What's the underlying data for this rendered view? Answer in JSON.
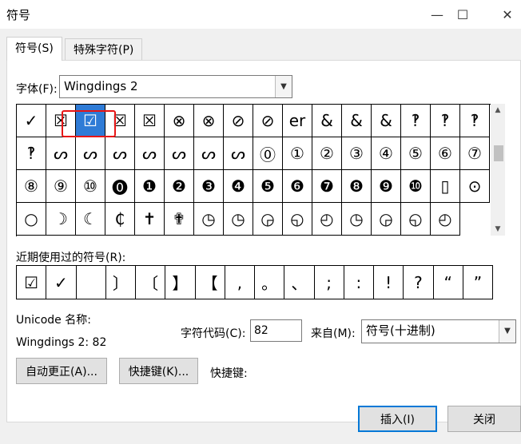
{
  "window": {
    "title": "符号",
    "minimize": "—",
    "maximize": "☐",
    "close": "✕"
  },
  "tabs": [
    {
      "label": "符号(S)"
    },
    {
      "label": "特殊字符(P)"
    }
  ],
  "font": {
    "label": "字体(F):",
    "value": "Wingdings 2"
  },
  "symbol_rows": [
    [
      "✓",
      "☒",
      "☑",
      "☒",
      "☒",
      "⊗",
      "⊗",
      "⊘",
      "⊘",
      "er",
      "&",
      "&",
      "&",
      "‽",
      "‽",
      "‽"
    ],
    [
      "‽",
      "ᔕ",
      "ᔕ",
      "ᔕ",
      "ᔕ",
      "ᔕ",
      "ᔕ",
      "ᔕ",
      "⓪",
      "①",
      "②",
      "③",
      "④",
      "⑤",
      "⑥"
    ],
    [
      "⑦",
      "⑧",
      "⑨",
      "⑩",
      "⓿",
      "❶",
      "❷",
      "❸",
      "❹",
      "❺",
      "❻",
      "❼",
      "❽",
      "❾",
      "❿",
      "▯"
    ],
    [
      "⊙",
      "○",
      "☽",
      "☾",
      "₵",
      "✝",
      "✟",
      "◷",
      "◷",
      "◶",
      "◵",
      "◴",
      "◷",
      "◶",
      "◵",
      "◴"
    ]
  ],
  "selected_index": 2,
  "recent": {
    "label": "近期使用过的符号(R):",
    "items": [
      "☑",
      "✓",
      "",
      "〕",
      "〔",
      "】",
      "【",
      ",",
      "。",
      "、",
      ";",
      ":",
      "!",
      "?",
      "“",
      "”"
    ]
  },
  "unicode": {
    "label": "Unicode 名称:",
    "name": "Wingdings 2: 82"
  },
  "char_code": {
    "label": "字符代码(C):",
    "value": "82"
  },
  "from": {
    "label": "来自(M):",
    "value": "符号(十进制)"
  },
  "buttons": {
    "autocorrect": "自动更正(A)...",
    "shortcut_key": "快捷键(K)...",
    "shortcut_label": "快捷键:",
    "insert": "插入(I)",
    "close": "关闭"
  }
}
